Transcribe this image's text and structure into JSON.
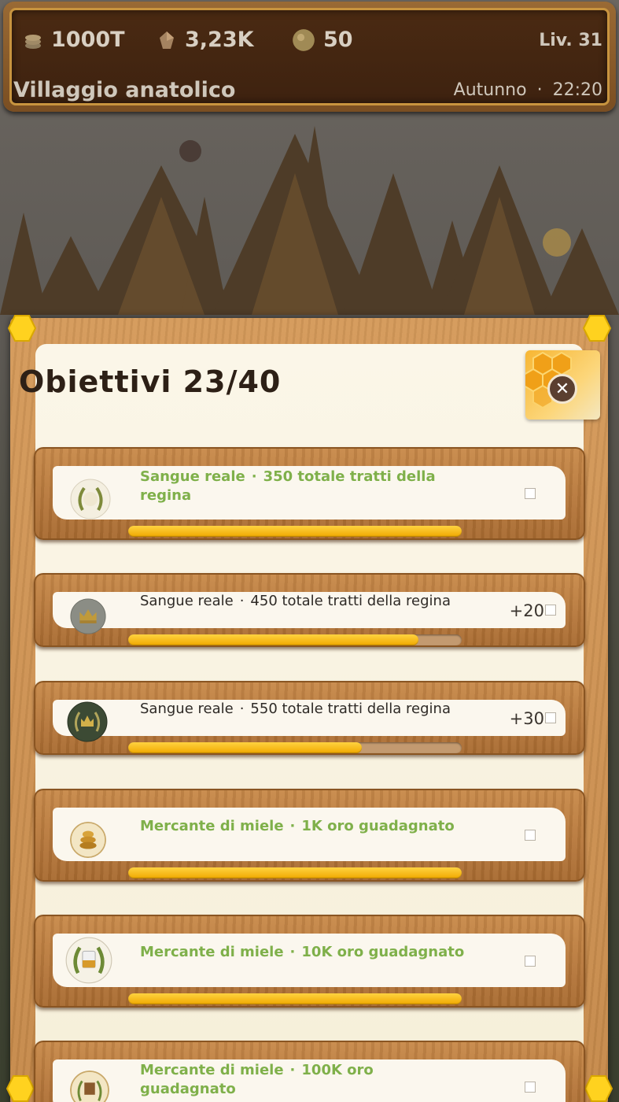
{
  "hud": {
    "resources": [
      {
        "icon": "coin-stack-icon",
        "value": "1000T"
      },
      {
        "icon": "wax-crystal-icon",
        "value": "3,23K"
      },
      {
        "icon": "honey-orb-icon",
        "value": "50"
      }
    ],
    "level": "Liv. 31",
    "village": "Villaggio anatolico",
    "season": "Autunno",
    "separator": "·",
    "time": "22:20"
  },
  "panel": {
    "title": "Obiettivi 23/40",
    "close_icon": "close-icon"
  },
  "objectives": [
    {
      "category": "Sangue reale",
      "separator": "·",
      "goal": "350 totale tratti della regina",
      "reward": "",
      "completed": true,
      "progress": 1.0,
      "medal_icon": "laurel-wreath-icon"
    },
    {
      "category": "Sangue reale",
      "separator": "·",
      "goal": "450 totale tratti della regina",
      "reward": "+20",
      "completed": false,
      "progress": 0.87,
      "medal_icon": "crown-medal-icon"
    },
    {
      "category": "Sangue reale",
      "separator": "·",
      "goal": "550 totale tratti della regina",
      "reward": "+30",
      "completed": false,
      "progress": 0.7,
      "medal_icon": "crown-laurel-medal-icon"
    },
    {
      "category": "Mercante di miele",
      "separator": "·",
      "goal": "1K oro guadagnato",
      "reward": "",
      "completed": true,
      "progress": 1.0,
      "medal_icon": "beehive-coin-icon"
    },
    {
      "category": "Mercante di miele",
      "separator": "·",
      "goal": "10K oro guadagnato",
      "reward": "",
      "completed": true,
      "progress": 1.0,
      "medal_icon": "honey-jar-laurel-icon"
    },
    {
      "category": "Mercante di miele",
      "separator": "·",
      "goal": "100K oro guadagnato",
      "reward": "",
      "completed": true,
      "progress": 1.0,
      "medal_icon": "honey-crate-icon"
    }
  ],
  "colors": {
    "completed_text": "#7fb04a",
    "pending_text": "#2e2a26",
    "progress_fill": "#f0a800",
    "gem": "#ffd21f"
  }
}
